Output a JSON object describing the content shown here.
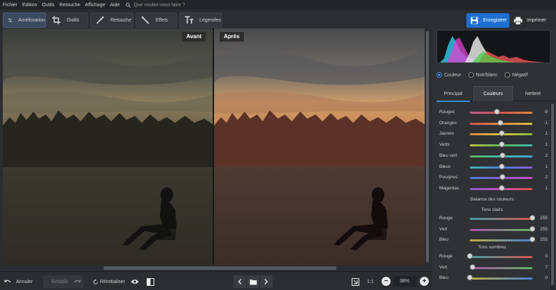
{
  "menu": {
    "items": [
      "Fichier",
      "Edition",
      "Outils",
      "Retouche",
      "Affichage",
      "Aide"
    ],
    "search_placeholder": "Que voulez-vous faire ?"
  },
  "toolbar": {
    "tabs": [
      {
        "label": "Amélioration",
        "icon": "sliders-icon",
        "active": true
      },
      {
        "label": "Outils",
        "icon": "crop-icon",
        "active": false
      },
      {
        "label": "Retouche",
        "icon": "brush-icon",
        "active": false
      },
      {
        "label": "Effets",
        "icon": "magic-wand-icon",
        "active": false
      },
      {
        "label": "Légendes",
        "icon": "text-icon",
        "active": false
      }
    ],
    "save_label": "Enregistrer",
    "print_label": "Imprimer"
  },
  "viewer": {
    "before_label": "Avant",
    "after_label": "Après"
  },
  "bottombar": {
    "undo_label": "Annuler",
    "redo_label": "Rétablir",
    "reset_label": "Réinitialiser",
    "zoom_fit": "1:1",
    "zoom_value": "38%"
  },
  "panel": {
    "color_modes": [
      {
        "label": "Couleur",
        "selected": true
      },
      {
        "label": "Noir/blanc",
        "selected": false
      },
      {
        "label": "Négatif",
        "selected": false
      }
    ],
    "tabs": [
      {
        "label": "Principal",
        "active": false
      },
      {
        "label": "Couleurs",
        "active": true
      },
      {
        "label": "Netteté",
        "active": false
      }
    ],
    "hue_sliders": [
      {
        "label": "Rouges",
        "value": "-9",
        "pos": 0.43,
        "color": "#d9534f"
      },
      {
        "label": "Oranges",
        "value": "-1",
        "pos": 0.49,
        "color": "#e08a3c"
      },
      {
        "label": "Jaunes",
        "value": "1",
        "pos": 0.51,
        "color": "#d8c040"
      },
      {
        "label": "Verts",
        "value": "1",
        "pos": 0.51,
        "color": "#5cb85c"
      },
      {
        "label": "Bleu vert",
        "value": "2",
        "pos": 0.52,
        "color": "#40b8a8"
      },
      {
        "label": "Bleus",
        "value": "1",
        "pos": 0.51,
        "color": "#4a7fd8"
      },
      {
        "label": "Pourpres",
        "value": "2",
        "pos": 0.52,
        "color": "#8a5ad0"
      },
      {
        "label": "Magentas",
        "value": "1",
        "pos": 0.51,
        "color": "#c850b8"
      }
    ],
    "balance_title": "Balance des couleurs",
    "highlights_title": "Tons clairs",
    "highlights": [
      {
        "label": "Rouge",
        "value": "255",
        "pos": 1.0,
        "color": "#d9534f"
      },
      {
        "label": "Vert",
        "value": "255",
        "pos": 1.0,
        "color": "#5cb85c"
      },
      {
        "label": "Bleu",
        "value": "255",
        "pos": 1.0,
        "color": "#4a7fd8"
      }
    ],
    "shadows_title": "Tons sombres",
    "shadows": [
      {
        "label": "Rouge",
        "value": "0",
        "pos": 0.0,
        "color": "#d9534f"
      },
      {
        "label": "Vert",
        "value": "7",
        "pos": 0.04,
        "color": "#5cb85c"
      },
      {
        "label": "Bleu",
        "value": "0",
        "pos": 0.0,
        "color": "#4a7fd8"
      }
    ]
  }
}
